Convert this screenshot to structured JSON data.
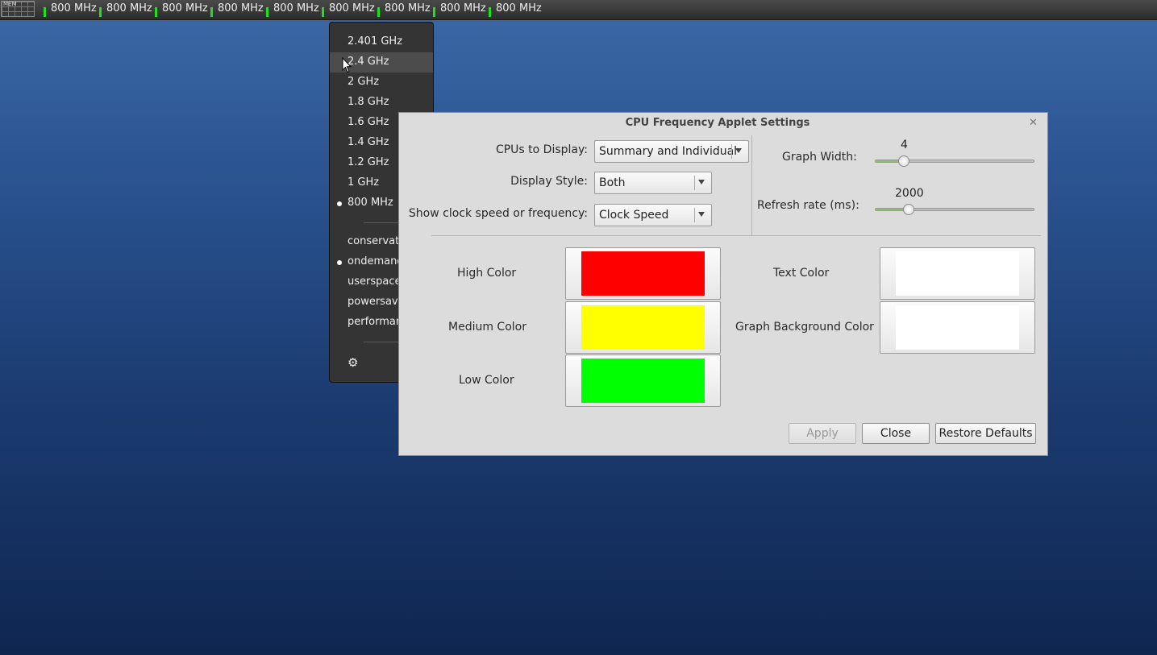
{
  "panel": {
    "mem_label": "MEM",
    "cpu_items": [
      "800 MHz",
      "800 MHz",
      "800 MHz",
      "800 MHz",
      "800 MHz",
      "800 MHz",
      "800 MHz",
      "800 MHz",
      "800 MHz"
    ],
    "bar_color": "#22dd22"
  },
  "menu": {
    "frequencies": [
      {
        "label": "2.401 GHz",
        "selected": false
      },
      {
        "label": "2.4 GHz",
        "selected": false,
        "hover": true
      },
      {
        "label": "2 GHz",
        "selected": false
      },
      {
        "label": "1.8 GHz",
        "selected": false
      },
      {
        "label": "1.6 GHz",
        "selected": false
      },
      {
        "label": "1.4 GHz",
        "selected": false
      },
      {
        "label": "1.2 GHz",
        "selected": false
      },
      {
        "label": "1 GHz",
        "selected": false
      },
      {
        "label": "800 MHz",
        "selected": true
      }
    ],
    "governors": [
      {
        "label": "conservative",
        "selected": false
      },
      {
        "label": "ondemand",
        "selected": true
      },
      {
        "label": "userspace",
        "selected": false
      },
      {
        "label": "powersave",
        "selected": false
      },
      {
        "label": "performance",
        "selected": false
      }
    ],
    "settings_icon": "gear-icon"
  },
  "dialog": {
    "title": "CPU Frequency Applet Settings",
    "cpus_label": "CPUs to Display:",
    "cpus_value": "Summary and Individual",
    "style_label": "Display Style:",
    "style_value": "Both",
    "clock_label": "Show clock speed or frequency:",
    "clock_value": "Clock Speed",
    "graph_width_label": "Graph Width:",
    "graph_width_value": "4",
    "graph_width_fraction": 0.18,
    "refresh_label": "Refresh rate (ms):",
    "refresh_value": "2000",
    "refresh_fraction": 0.21,
    "high_color_label": "High Color",
    "medium_color_label": "Medium Color",
    "low_color_label": "Low Color",
    "text_color_label": "Text Color",
    "graph_bg_label": "Graph Background Color",
    "colors": {
      "high": "#ff0000",
      "medium": "#ffff00",
      "low": "#00ff00",
      "text": "#ffffff",
      "graph_bg": "#ffffff"
    },
    "apply_label": "Apply",
    "close_label": "Close",
    "restore_label": "Restore Defaults"
  }
}
